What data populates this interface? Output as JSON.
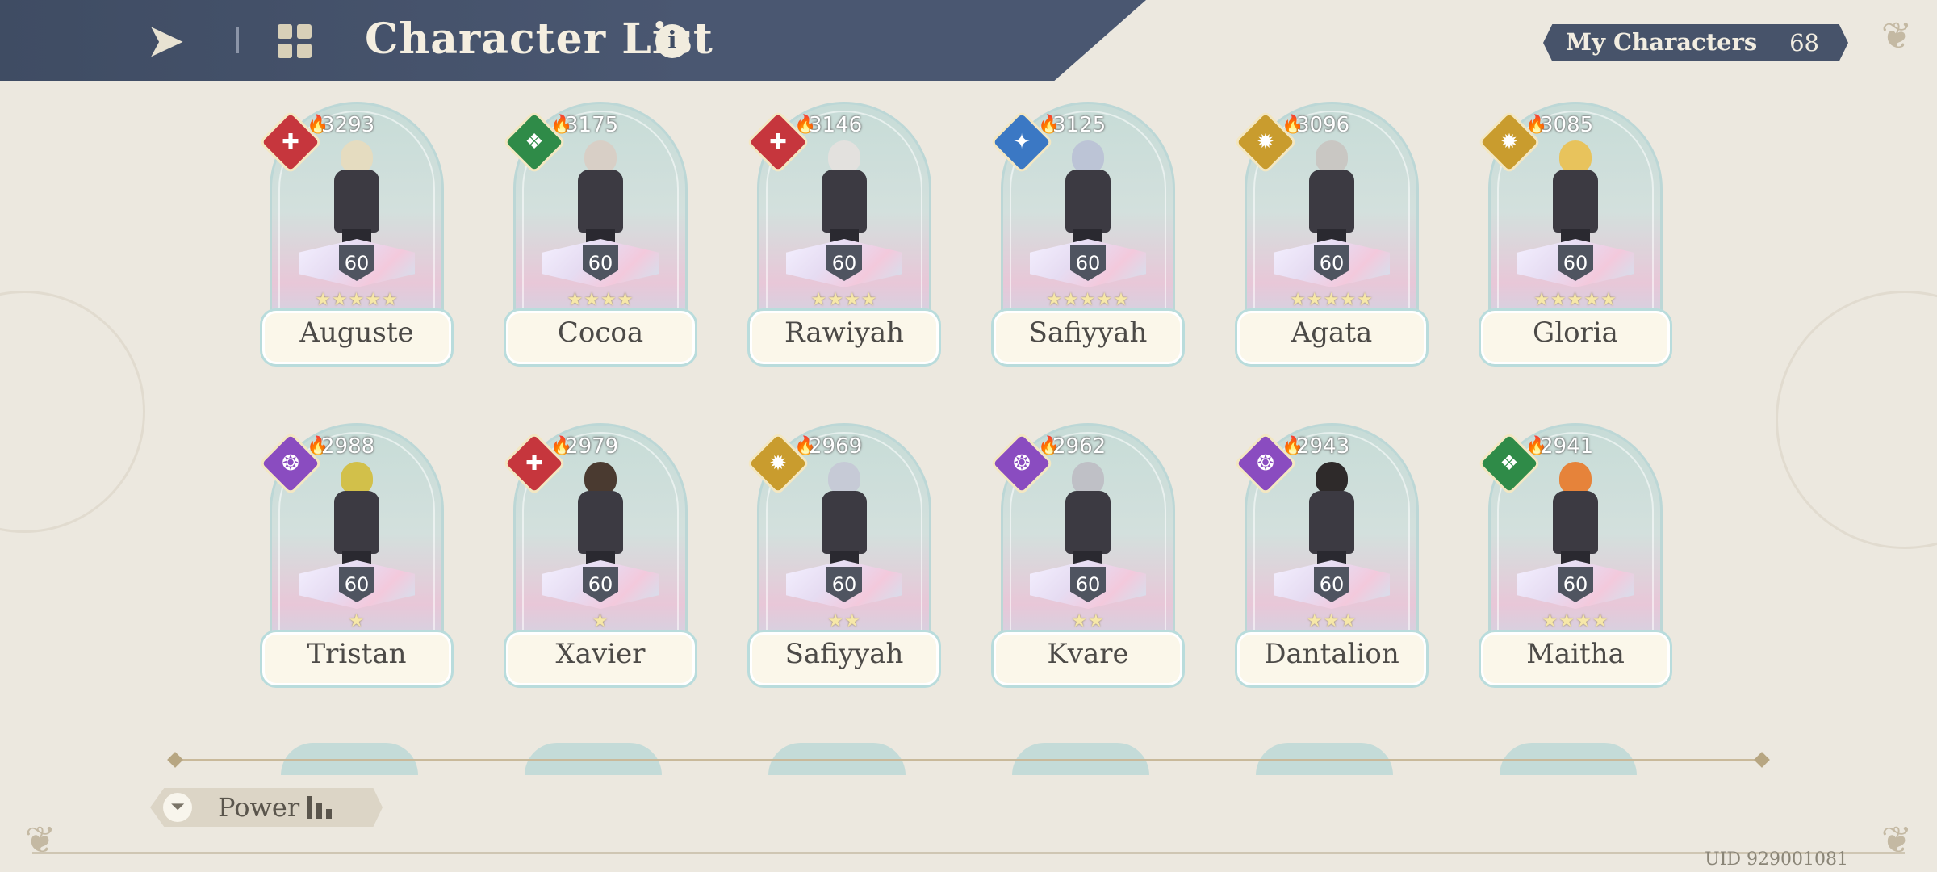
{
  "header": {
    "title": "Character List",
    "info_icon": "i",
    "back_icon": "back-arrow-icon",
    "grid_icon": "grid-icon"
  },
  "counter": {
    "label": "My Characters",
    "count": "68"
  },
  "characters": [
    {
      "name": "Auguste",
      "power": "3293",
      "level": "60",
      "stars": 5,
      "element": "red",
      "hair": "#e5dcc0"
    },
    {
      "name": "Cocoa",
      "power": "3175",
      "level": "60",
      "stars": 4,
      "element": "green",
      "hair": "#d8cfc6"
    },
    {
      "name": "Rawiyah",
      "power": "3146",
      "level": "60",
      "stars": 4,
      "element": "red",
      "hair": "#e3e1de"
    },
    {
      "name": "Safiyyah",
      "power": "3125",
      "level": "60",
      "stars": 5,
      "element": "blue",
      "hair": "#bcc4d6"
    },
    {
      "name": "Agata",
      "power": "3096",
      "level": "60",
      "stars": 5,
      "element": "gold",
      "hair": "#c9c7c3"
    },
    {
      "name": "Gloria",
      "power": "3085",
      "level": "60",
      "stars": 5,
      "element": "gold",
      "hair": "#e8c35c"
    },
    {
      "name": "Tristan",
      "power": "2988",
      "level": "60",
      "stars": 1,
      "element": "purple",
      "hair": "#d2c04a"
    },
    {
      "name": "Xavier",
      "power": "2979",
      "level": "60",
      "stars": 1,
      "element": "red",
      "hair": "#4a3a30"
    },
    {
      "name": "Safiyyah",
      "power": "2969",
      "level": "60",
      "stars": 2,
      "element": "gold",
      "hair": "#c6cad6"
    },
    {
      "name": "Kvare",
      "power": "2962",
      "level": "60",
      "stars": 2,
      "element": "purple",
      "hair": "#bfc0c6"
    },
    {
      "name": "Dantalion",
      "power": "2943",
      "level": "60",
      "stars": 3,
      "element": "purple",
      "hair": "#2e2a2a"
    },
    {
      "name": "Maitha",
      "power": "2941",
      "level": "60",
      "stars": 4,
      "element": "green",
      "hair": "#e6833a"
    }
  ],
  "sort": {
    "label": "Power",
    "icon": "filter-icon",
    "order_icon": "sort-bars-icon"
  },
  "uid": "UID 929001081"
}
